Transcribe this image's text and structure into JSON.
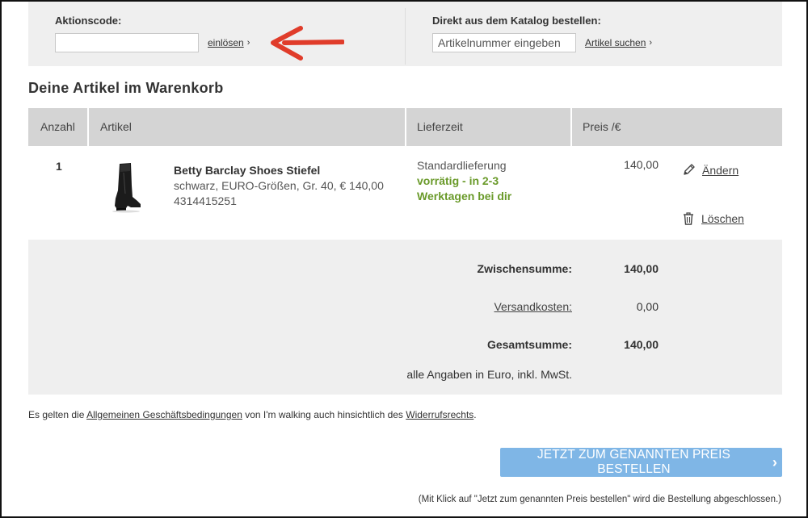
{
  "promo": {
    "label": "Aktionscode:",
    "input_value": "",
    "redeem_link": "einlösen",
    "chevron": "›"
  },
  "catalog": {
    "label": "Direkt aus dem Katalog bestellen:",
    "input_placeholder": "Artikelnummer eingeben",
    "search_link": "Artikel suchen",
    "chevron": "›"
  },
  "annotation": {
    "arrow_color": "#e03c2a"
  },
  "cart": {
    "title": "Deine Artikel im Warenkorb",
    "columns": {
      "qty": "Anzahl",
      "article": "Artikel",
      "delivery": "Lieferzeit",
      "price": "Preis /€"
    },
    "items": [
      {
        "qty": "1",
        "name": "Betty Barclay Shoes Stiefel",
        "details": "schwarz, EURO-Größen, Gr. 40, € 140,00",
        "article_number": "4314415251",
        "delivery_type": "Standardlieferung",
        "availability_line1": "vorrätig - in 2-3",
        "availability_line2": "Werktagen bei dir",
        "price": "140,00",
        "edit_label": "Ändern",
        "delete_label": "Löschen"
      }
    ]
  },
  "summary": {
    "subtotal_label": "Zwischensumme:",
    "subtotal_value": "140,00",
    "shipping_label": "Versandkosten:",
    "shipping_value": "0,00",
    "total_label": "Gesamtsumme:",
    "total_value": "140,00",
    "note": "alle Angaben in Euro, inkl. MwSt."
  },
  "legal": {
    "part1": "Es gelten die ",
    "terms_link": "Allgemeinen Geschäftsbedingungen",
    "part2": " von I'm walking auch hinsichtlich des ",
    "withdrawal_link": "Widerrufsrechts",
    "part3": "."
  },
  "order": {
    "button_label": "JETZT ZUM GENANNTEN PREIS BESTELLEN",
    "button_chevron": "›",
    "note": "(Mit Klick auf \"Jetzt zum genannten Preis bestellen\" wird die Bestellung abgeschlossen.)"
  },
  "colors": {
    "panel_bg": "#efefef",
    "header_bg": "#d4d4d4",
    "stock_green": "#6a9a2a",
    "button_blue": "#7fb6e6"
  }
}
